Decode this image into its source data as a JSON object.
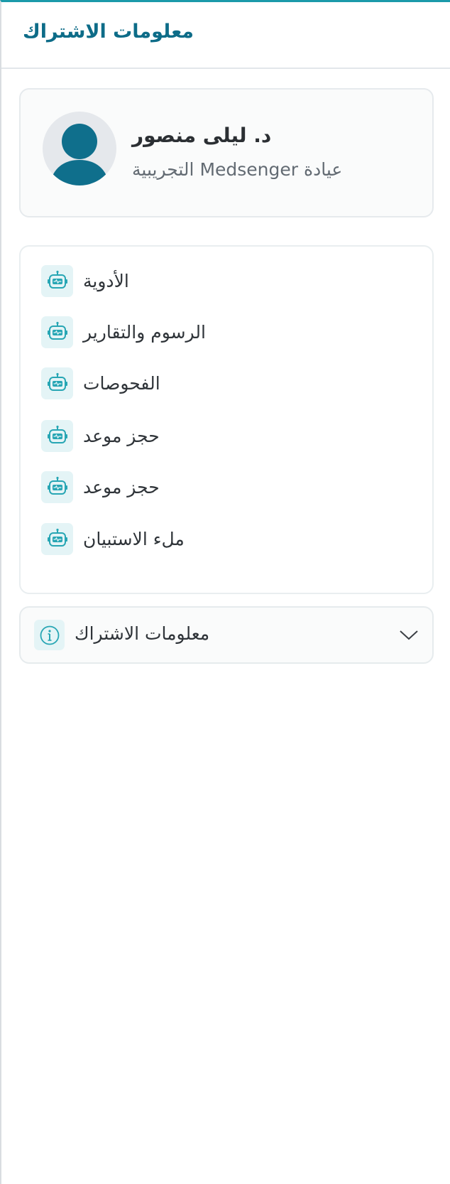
{
  "header": {
    "title": "معلومات الاشتراك"
  },
  "profile": {
    "name": "د. ليلى منصور",
    "clinic": "عيادة Medsenger التجريبية",
    "avatar_icon": "user-avatar-icon"
  },
  "menu": {
    "items": [
      {
        "label": "الأدوية",
        "icon": "robot-icon"
      },
      {
        "label": "الرسوم والتقارير",
        "icon": "robot-icon"
      },
      {
        "label": "الفحوصات",
        "icon": "robot-icon"
      },
      {
        "label": "حجز موعد",
        "icon": "robot-icon"
      },
      {
        "label": "حجز موعد",
        "icon": "robot-icon"
      },
      {
        "label": "ملء الاستبيان",
        "icon": "robot-icon"
      }
    ]
  },
  "subscription": {
    "label": "معلومات الاشتراك",
    "icon": "info-icon",
    "toggle_icon": "chevron-down-icon"
  },
  "colors": {
    "accent": "#1b9aaa",
    "title": "#0d6c88",
    "avatar": "#0f6f8c",
    "icon_bg": "#e4f4f6"
  }
}
